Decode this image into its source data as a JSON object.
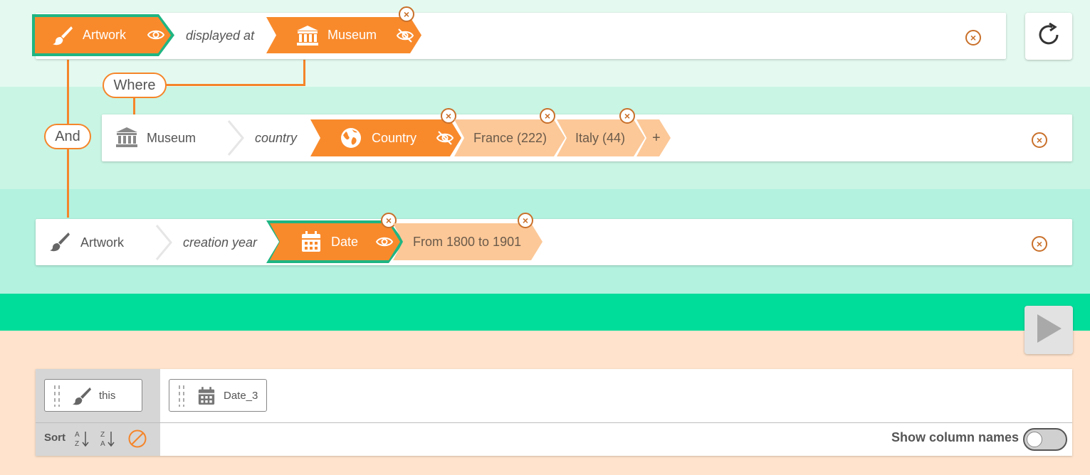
{
  "query": {
    "row1": {
      "subject": "Artwork",
      "predicate": "displayed at",
      "object": "Museum"
    },
    "connectors": {
      "where": "Where",
      "and": "And"
    },
    "row2": {
      "subject": "Museum",
      "predicate": "country",
      "object": "Country",
      "values": [
        "France (222)",
        "Italy (44)"
      ],
      "add": "+"
    },
    "row3": {
      "subject": "Artwork",
      "predicate": "creation year",
      "object": "Date",
      "range": "From 1800 to 1901"
    }
  },
  "results": {
    "columns": [
      "this",
      "Date_3"
    ],
    "sort_label": "Sort",
    "show_column_names": "Show column names"
  },
  "colors": {
    "accent_orange": "#f88a2c",
    "light_orange": "#fcc898",
    "green": "#00dd9b",
    "selected_border": "#1fb582"
  },
  "icons": [
    "paintbrush-icon",
    "eye-icon",
    "museum-icon",
    "eye-slash-icon",
    "globe-icon",
    "calendar-icon",
    "close-icon",
    "refresh-icon",
    "play-icon",
    "drag-handle-icon",
    "sort-az-icon",
    "sort-za-icon",
    "no-sort-icon"
  ]
}
